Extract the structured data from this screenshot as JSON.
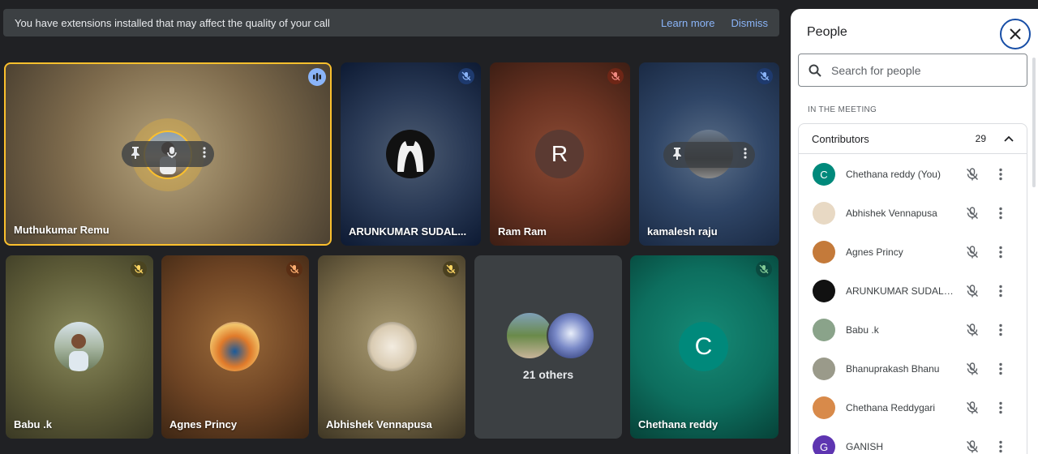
{
  "banner": {
    "message": "You have extensions installed that may affect the quality of your call",
    "learn_more": "Learn more",
    "dismiss": "Dismiss"
  },
  "tiles": [
    {
      "name": "Muthukumar Remu",
      "mic": "speaking"
    },
    {
      "name": "ARUNKUMAR SUDAL...",
      "mic": "muted"
    },
    {
      "name": "Ram Ram",
      "initial": "R",
      "mic": "muted"
    },
    {
      "name": "kamalesh raju",
      "mic": "muted"
    },
    {
      "name": "Babu .k",
      "mic": "muted"
    },
    {
      "name": "Agnes Princy",
      "mic": "muted"
    },
    {
      "name": "Abhishek Vennapusa",
      "mic": "muted"
    },
    {
      "others_label": "21 others"
    },
    {
      "name": "Chethana reddy",
      "initial": "C",
      "mic": "muted"
    }
  ],
  "panel": {
    "title": "People",
    "search_placeholder": "Search for people",
    "section_label": "IN THE MEETING",
    "contributors_label": "Contributors",
    "contributors_count": "29",
    "people": [
      {
        "name": "Chethana reddy (You)",
        "initial": "C",
        "color": "#00897b"
      },
      {
        "name": "Abhishek Vennapusa",
        "color": "#e8d9c4"
      },
      {
        "name": "Agnes Princy",
        "color": "#c47a3a"
      },
      {
        "name": "ARUNKUMAR SUDALAI...",
        "color": "#111111"
      },
      {
        "name": "Babu .k",
        "color": "#8aa38a"
      },
      {
        "name": "Bhanuprakash Bhanu",
        "color": "#9a9a8a"
      },
      {
        "name": "Chethana Reddygari",
        "color": "#d88a4a"
      },
      {
        "name": "GANISH",
        "initial": "G",
        "color": "#5e35b1"
      }
    ]
  },
  "colors": {
    "accent_blue": "#8ab4f8",
    "active_speaker_border": "#fbc02d",
    "panel_bg": "#ffffff",
    "teal": "#00796b"
  }
}
